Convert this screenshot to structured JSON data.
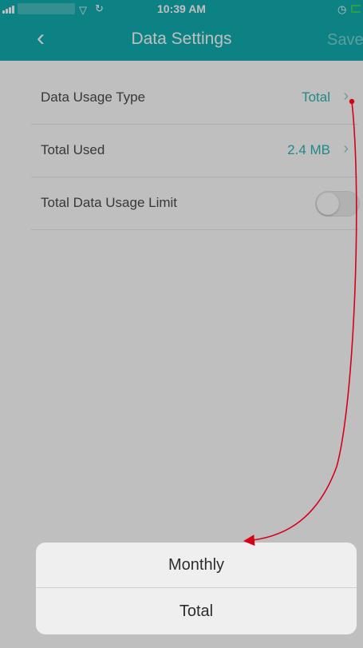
{
  "status_bar": {
    "time": "10:39 AM",
    "wifi_icon": "wifi-icon",
    "loading_icon": "loading-icon",
    "alarm_icon": "alarm-icon"
  },
  "nav": {
    "back_icon": "chevron-left-icon",
    "title": "Data Settings",
    "save_label": "Save"
  },
  "settings": {
    "items": [
      {
        "label": "Data Usage Type",
        "value": "Total"
      },
      {
        "label": "Total Used",
        "value": "2.4 MB"
      },
      {
        "label": "Total Data Usage Limit",
        "toggle_state": "off"
      }
    ]
  },
  "action_sheet": {
    "options": [
      "Monthly",
      "Total"
    ]
  },
  "colors": {
    "accent": "#12aeb0",
    "value_text": "#2eb6b6",
    "annotation_arrow": "#d60018"
  }
}
